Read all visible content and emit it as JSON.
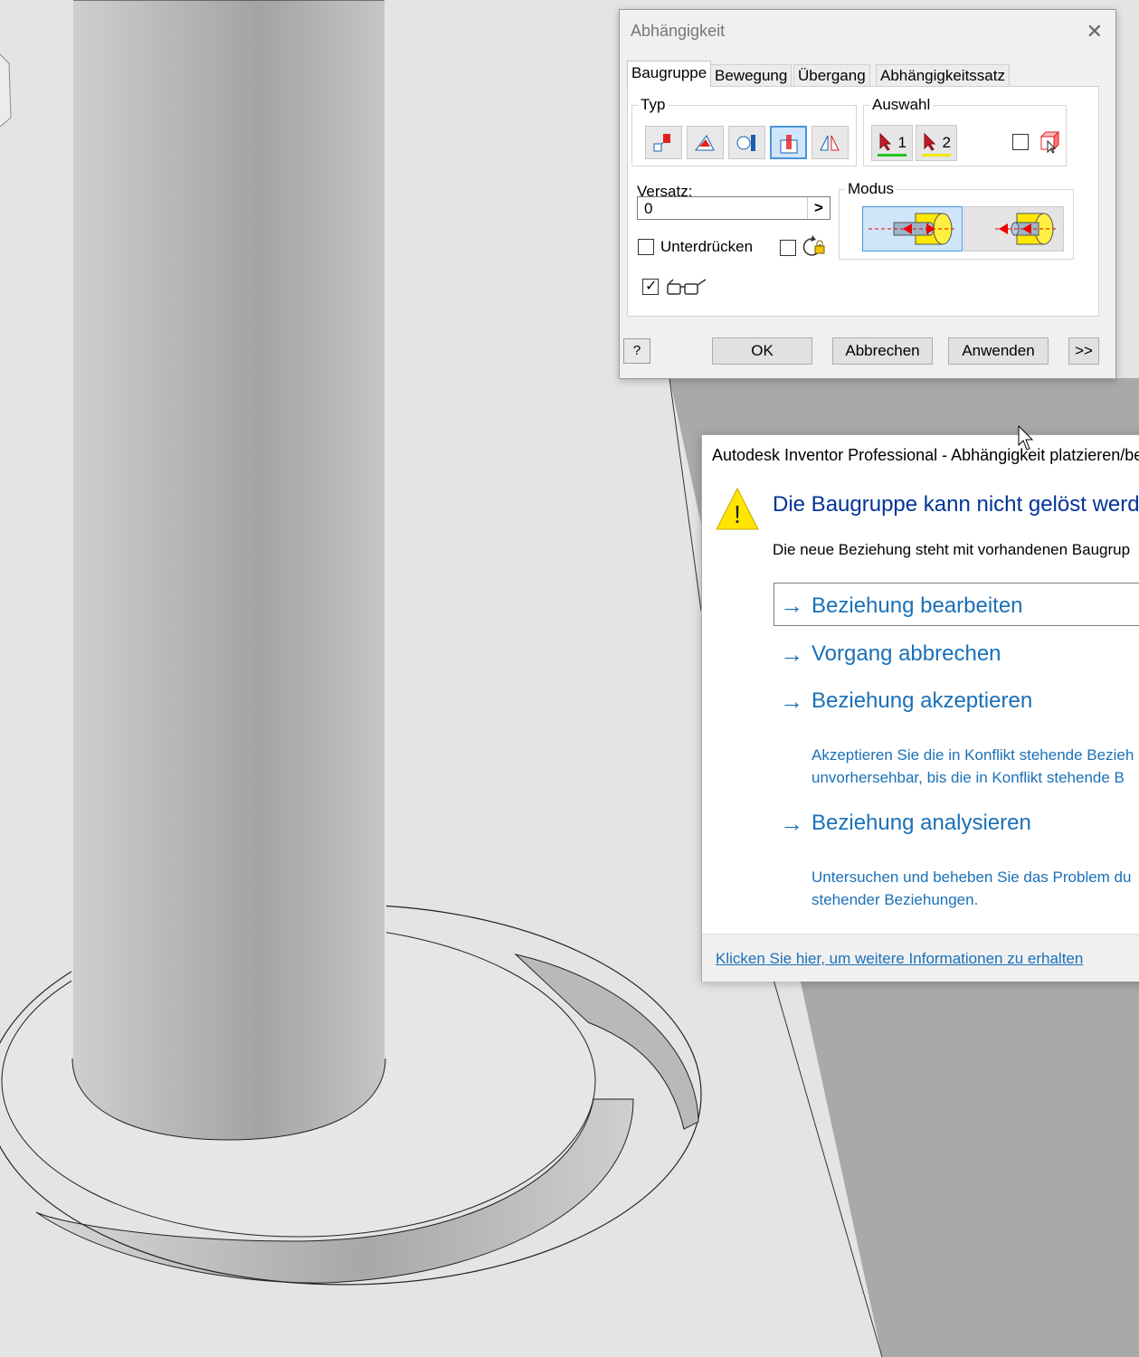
{
  "constraint_dialog": {
    "title": "Abhängigkeit",
    "close_symbol": "✕",
    "tabs": [
      "Baugruppe",
      "Bewegung",
      "Übergang",
      "Abhängigkeitssatz"
    ],
    "type_group_label": "Typ",
    "type_buttons": [
      "mate-icon",
      "angle-icon",
      "tangent-icon",
      "insert-icon",
      "symmetry-icon"
    ],
    "selected_type": "insert-icon",
    "selection_group_label": "Auswahl",
    "pick_1_label": "1",
    "pick_2_label": "2",
    "pick_1_color": "#22c422",
    "pick_2_color": "#f2e600",
    "offset_label": "Versatz:",
    "offset_value": "0",
    "offset_arrow": ">",
    "mode_group_label": "Modus",
    "suppress_label": "Unterdrücken",
    "suppress_checked": false,
    "predict_offset_checked": false,
    "show_preview_checked": true,
    "ok_label": "OK",
    "cancel_label": "Abbrechen",
    "apply_label": "Anwenden",
    "more_label": ">>",
    "help_symbol": "?"
  },
  "error_dialog": {
    "title": "Autodesk Inventor Professional - Abhängigkeit platzieren/be",
    "heading": "Die Baugruppe kann nicht gelöst werd",
    "message": "Die neue Beziehung steht mit vorhandenen Baugrup",
    "commands": [
      {
        "label": "Beziehung bearbeiten",
        "description": []
      },
      {
        "label": "Vorgang abbrechen",
        "description": []
      },
      {
        "label": "Beziehung akzeptieren",
        "description": [
          "Akzeptieren Sie die in Konflikt stehende Bezieh",
          "unvorhersehbar, bis die in Konflikt stehende B"
        ]
      },
      {
        "label": "Beziehung analysieren",
        "description": [
          "Untersuchen und beheben Sie das Problem du",
          "stehender Beziehungen."
        ]
      }
    ],
    "arrow_symbol": "→",
    "warning_symbol": "!",
    "footer_link": "Klicken Sie hier, um weitere Informationen zu erhalten",
    "heading_color": "#003399",
    "link_color": "#1a70b8",
    "warning_color": "#ffe500"
  }
}
